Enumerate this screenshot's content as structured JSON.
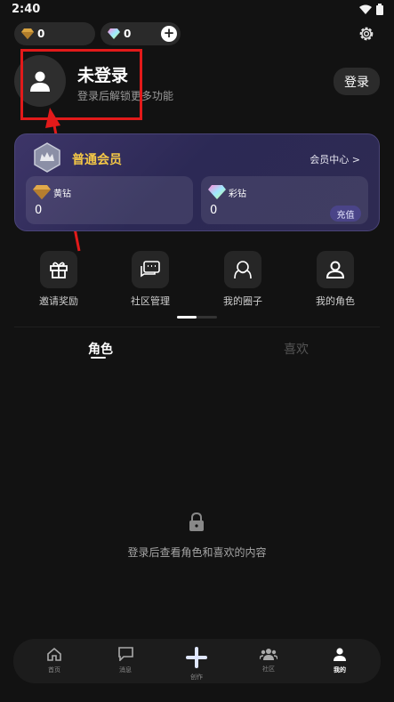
{
  "status_bar": {
    "time": "2:40"
  },
  "wallet": {
    "gold_count": "0",
    "rainbow_count": "0",
    "add_symbol": "+"
  },
  "profile": {
    "name": "未登录",
    "subtitle": "登录后解锁更多功能",
    "login_label": "登录"
  },
  "membership": {
    "title": "普通会员",
    "center_link": "会员中心 >",
    "gold": {
      "label": "黄钻",
      "value": "0"
    },
    "rainbow": {
      "label": "彩钻",
      "value": "0",
      "recharge_label": "充值"
    }
  },
  "menu": {
    "items": [
      {
        "label": "邀请奖励",
        "icon": "gift-icon"
      },
      {
        "label": "社区管理",
        "icon": "chat-icon"
      },
      {
        "label": "我的圈子",
        "icon": "circle-icon"
      },
      {
        "label": "我的角色",
        "icon": "person-icon"
      }
    ]
  },
  "tabs": {
    "active": "角色",
    "inactive": "喜欢"
  },
  "empty_state": {
    "message": "登录后查看角色和喜欢的内容",
    "icon": "lock-icon"
  },
  "bottom_nav": {
    "items": [
      {
        "label": "首页",
        "icon": "home-icon"
      },
      {
        "label": "消息",
        "icon": "message-icon"
      },
      {
        "label": "创作",
        "icon": "plus-icon"
      },
      {
        "label": "社区",
        "icon": "community-icon"
      },
      {
        "label": "我的",
        "icon": "profile-icon"
      }
    ],
    "active_index": 4
  },
  "colors": {
    "background": "#121212",
    "member_gold": "#f5c846",
    "annotation_red": "#e21a1a",
    "card_purple": "#2c2955"
  }
}
